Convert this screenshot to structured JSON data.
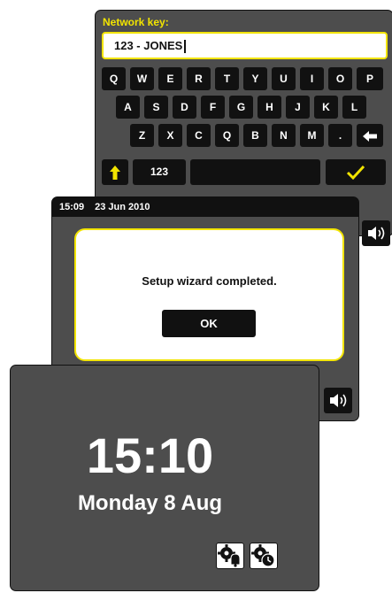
{
  "keyboard_screen": {
    "title": "Network key:",
    "entry_value": "123 - JONES",
    "row1": [
      "Q",
      "W",
      "E",
      "R",
      "T",
      "Y",
      "U",
      "I",
      "O",
      "P"
    ],
    "row2": [
      "A",
      "S",
      "D",
      "F",
      "G",
      "H",
      "J",
      "K",
      "L"
    ],
    "row3": [
      "Z",
      "X",
      "C",
      "Q",
      "B",
      "N",
      "M",
      "."
    ],
    "numeric_label": "123",
    "icons": {
      "backspace": "left-arrow-icon",
      "shift": "up-arrow-icon",
      "enter": "checkmark-icon",
      "volume": "speaker-icon"
    }
  },
  "dialog_screen": {
    "time": "15:09",
    "date": "23 Jun 2010",
    "message": "Setup wizard completed.",
    "ok_label": "OK",
    "icons": {
      "volume": "speaker-icon"
    }
  },
  "clock_screen": {
    "time": "15:10",
    "date": "Monday 8 Aug",
    "icons": {
      "alarm": "alarm-settings-icon",
      "sleep": "sleep-timer-icon"
    }
  },
  "colors": {
    "accent": "#f2e400",
    "panel": "#4d4d4d",
    "key": "#111111",
    "text_light": "#ffffff"
  }
}
